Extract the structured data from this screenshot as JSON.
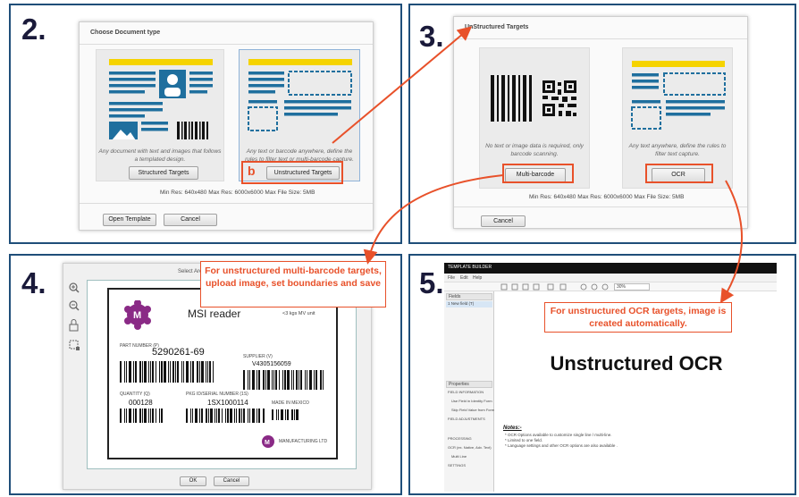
{
  "step2": {
    "number": "2.",
    "title": "Choose Document type",
    "structured": {
      "description": "Any document with text and images that follows a templated design.",
      "button": "Structured Targets"
    },
    "unstructured": {
      "marker": "b",
      "description": "Any text or barcode anywhere, define the rules to filter text or multi-barcode capture.",
      "button": "Unstructured Targets"
    },
    "meta": "Min Res: 640x480   Max Res: 6000x6000   Max File Size: 5MB",
    "open_template": "Open Template",
    "cancel": "Cancel"
  },
  "step3": {
    "number": "3.",
    "title": "UnStructured Targets",
    "multibarcode": {
      "description": "No text or image data is required, only barcode scanning.",
      "button": "Multi-barcode"
    },
    "ocr": {
      "description": "Any text anywhere, define the rules to filter text capture.",
      "button": "OCR"
    },
    "meta": "Min Res: 640x480   Max Res: 6000x6000   Max File Size: 5MB",
    "cancel": "Cancel"
  },
  "step4": {
    "number": "4.",
    "callout": "For unstructured multi-barcode targets, upload image, set boundaries and save",
    "dialog_title": "Select Area",
    "label": {
      "title": "MSI reader",
      "weight": "<3 kgs  MV unit",
      "part_number_label": "PART NUMBER (P)",
      "part_number": "5290261-69",
      "supplier_label": "SUPPLIER (V)",
      "supplier": "V4305156059",
      "quantity_label": "QUANTITY (Q)",
      "quantity": "000128",
      "serial_label": "PKG ID/SERIAL NUMBER (1S)",
      "serial": "1SX1000114",
      "made_in": "MADE IN MEXICO",
      "manufacturer": "MANUFACTURING LTD"
    },
    "ok": "OK",
    "cancel": "Cancel"
  },
  "step5": {
    "number": "5.",
    "callout": "For unstructured OCR targets, image is created automatically.",
    "builder_title": "TEMPLATE BUILDER",
    "menu": [
      "File",
      "Edit",
      "Help"
    ],
    "zoom": "30%",
    "fields_label": "Fields",
    "field_item": "1  New field (T)",
    "properties_label": "Properties",
    "property_rows": [
      "FIELD INFORMATION",
      "Use Field in Identity Form",
      "Skip Field Value from Form",
      "FIELD ADJUSTMENTS",
      "PROCESSING",
      "OCR (ex. Native, Adv. Text)",
      "Multi Line",
      "SETTINGS"
    ],
    "canvas_text": "Unstructured OCR",
    "notes_title": "Notes:-",
    "notes": [
      "* OCR Options available to customize single line / multi-line.",
      "* Limited to one field.",
      "* Language settings and other OCR options are also available ."
    ]
  },
  "colors": {
    "accent": "#e8512a",
    "border": "#1f4e79",
    "illus_blue": "#1f6f9e",
    "illus_yellow": "#f5d300",
    "logo_purple": "#8a2a86"
  }
}
